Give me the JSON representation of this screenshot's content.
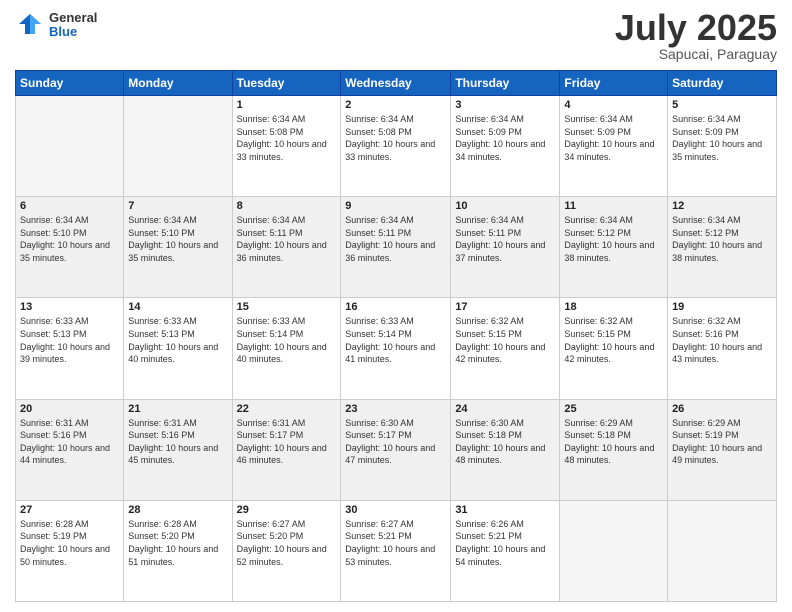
{
  "header": {
    "logo_general": "General",
    "logo_blue": "Blue",
    "month": "July 2025",
    "location": "Sapucai, Paraguay"
  },
  "weekdays": [
    "Sunday",
    "Monday",
    "Tuesday",
    "Wednesday",
    "Thursday",
    "Friday",
    "Saturday"
  ],
  "weeks": [
    [
      {
        "day": "",
        "sunrise": "",
        "sunset": "",
        "daylight": "",
        "empty": true
      },
      {
        "day": "",
        "sunrise": "",
        "sunset": "",
        "daylight": "",
        "empty": true
      },
      {
        "day": "1",
        "sunrise": "Sunrise: 6:34 AM",
        "sunset": "Sunset: 5:08 PM",
        "daylight": "Daylight: 10 hours and 33 minutes.",
        "empty": false
      },
      {
        "day": "2",
        "sunrise": "Sunrise: 6:34 AM",
        "sunset": "Sunset: 5:08 PM",
        "daylight": "Daylight: 10 hours and 33 minutes.",
        "empty": false
      },
      {
        "day": "3",
        "sunrise": "Sunrise: 6:34 AM",
        "sunset": "Sunset: 5:09 PM",
        "daylight": "Daylight: 10 hours and 34 minutes.",
        "empty": false
      },
      {
        "day": "4",
        "sunrise": "Sunrise: 6:34 AM",
        "sunset": "Sunset: 5:09 PM",
        "daylight": "Daylight: 10 hours and 34 minutes.",
        "empty": false
      },
      {
        "day": "5",
        "sunrise": "Sunrise: 6:34 AM",
        "sunset": "Sunset: 5:09 PM",
        "daylight": "Daylight: 10 hours and 35 minutes.",
        "empty": false
      }
    ],
    [
      {
        "day": "6",
        "sunrise": "Sunrise: 6:34 AM",
        "sunset": "Sunset: 5:10 PM",
        "daylight": "Daylight: 10 hours and 35 minutes.",
        "empty": false
      },
      {
        "day": "7",
        "sunrise": "Sunrise: 6:34 AM",
        "sunset": "Sunset: 5:10 PM",
        "daylight": "Daylight: 10 hours and 35 minutes.",
        "empty": false
      },
      {
        "day": "8",
        "sunrise": "Sunrise: 6:34 AM",
        "sunset": "Sunset: 5:11 PM",
        "daylight": "Daylight: 10 hours and 36 minutes.",
        "empty": false
      },
      {
        "day": "9",
        "sunrise": "Sunrise: 6:34 AM",
        "sunset": "Sunset: 5:11 PM",
        "daylight": "Daylight: 10 hours and 36 minutes.",
        "empty": false
      },
      {
        "day": "10",
        "sunrise": "Sunrise: 6:34 AM",
        "sunset": "Sunset: 5:11 PM",
        "daylight": "Daylight: 10 hours and 37 minutes.",
        "empty": false
      },
      {
        "day": "11",
        "sunrise": "Sunrise: 6:34 AM",
        "sunset": "Sunset: 5:12 PM",
        "daylight": "Daylight: 10 hours and 38 minutes.",
        "empty": false
      },
      {
        "day": "12",
        "sunrise": "Sunrise: 6:34 AM",
        "sunset": "Sunset: 5:12 PM",
        "daylight": "Daylight: 10 hours and 38 minutes.",
        "empty": false
      }
    ],
    [
      {
        "day": "13",
        "sunrise": "Sunrise: 6:33 AM",
        "sunset": "Sunset: 5:13 PM",
        "daylight": "Daylight: 10 hours and 39 minutes.",
        "empty": false
      },
      {
        "day": "14",
        "sunrise": "Sunrise: 6:33 AM",
        "sunset": "Sunset: 5:13 PM",
        "daylight": "Daylight: 10 hours and 40 minutes.",
        "empty": false
      },
      {
        "day": "15",
        "sunrise": "Sunrise: 6:33 AM",
        "sunset": "Sunset: 5:14 PM",
        "daylight": "Daylight: 10 hours and 40 minutes.",
        "empty": false
      },
      {
        "day": "16",
        "sunrise": "Sunrise: 6:33 AM",
        "sunset": "Sunset: 5:14 PM",
        "daylight": "Daylight: 10 hours and 41 minutes.",
        "empty": false
      },
      {
        "day": "17",
        "sunrise": "Sunrise: 6:32 AM",
        "sunset": "Sunset: 5:15 PM",
        "daylight": "Daylight: 10 hours and 42 minutes.",
        "empty": false
      },
      {
        "day": "18",
        "sunrise": "Sunrise: 6:32 AM",
        "sunset": "Sunset: 5:15 PM",
        "daylight": "Daylight: 10 hours and 42 minutes.",
        "empty": false
      },
      {
        "day": "19",
        "sunrise": "Sunrise: 6:32 AM",
        "sunset": "Sunset: 5:16 PM",
        "daylight": "Daylight: 10 hours and 43 minutes.",
        "empty": false
      }
    ],
    [
      {
        "day": "20",
        "sunrise": "Sunrise: 6:31 AM",
        "sunset": "Sunset: 5:16 PM",
        "daylight": "Daylight: 10 hours and 44 minutes.",
        "empty": false
      },
      {
        "day": "21",
        "sunrise": "Sunrise: 6:31 AM",
        "sunset": "Sunset: 5:16 PM",
        "daylight": "Daylight: 10 hours and 45 minutes.",
        "empty": false
      },
      {
        "day": "22",
        "sunrise": "Sunrise: 6:31 AM",
        "sunset": "Sunset: 5:17 PM",
        "daylight": "Daylight: 10 hours and 46 minutes.",
        "empty": false
      },
      {
        "day": "23",
        "sunrise": "Sunrise: 6:30 AM",
        "sunset": "Sunset: 5:17 PM",
        "daylight": "Daylight: 10 hours and 47 minutes.",
        "empty": false
      },
      {
        "day": "24",
        "sunrise": "Sunrise: 6:30 AM",
        "sunset": "Sunset: 5:18 PM",
        "daylight": "Daylight: 10 hours and 48 minutes.",
        "empty": false
      },
      {
        "day": "25",
        "sunrise": "Sunrise: 6:29 AM",
        "sunset": "Sunset: 5:18 PM",
        "daylight": "Daylight: 10 hours and 48 minutes.",
        "empty": false
      },
      {
        "day": "26",
        "sunrise": "Sunrise: 6:29 AM",
        "sunset": "Sunset: 5:19 PM",
        "daylight": "Daylight: 10 hours and 49 minutes.",
        "empty": false
      }
    ],
    [
      {
        "day": "27",
        "sunrise": "Sunrise: 6:28 AM",
        "sunset": "Sunset: 5:19 PM",
        "daylight": "Daylight: 10 hours and 50 minutes.",
        "empty": false
      },
      {
        "day": "28",
        "sunrise": "Sunrise: 6:28 AM",
        "sunset": "Sunset: 5:20 PM",
        "daylight": "Daylight: 10 hours and 51 minutes.",
        "empty": false
      },
      {
        "day": "29",
        "sunrise": "Sunrise: 6:27 AM",
        "sunset": "Sunset: 5:20 PM",
        "daylight": "Daylight: 10 hours and 52 minutes.",
        "empty": false
      },
      {
        "day": "30",
        "sunrise": "Sunrise: 6:27 AM",
        "sunset": "Sunset: 5:21 PM",
        "daylight": "Daylight: 10 hours and 53 minutes.",
        "empty": false
      },
      {
        "day": "31",
        "sunrise": "Sunrise: 6:26 AM",
        "sunset": "Sunset: 5:21 PM",
        "daylight": "Daylight: 10 hours and 54 minutes.",
        "empty": false
      },
      {
        "day": "",
        "sunrise": "",
        "sunset": "",
        "daylight": "",
        "empty": true
      },
      {
        "day": "",
        "sunrise": "",
        "sunset": "",
        "daylight": "",
        "empty": true
      }
    ]
  ]
}
